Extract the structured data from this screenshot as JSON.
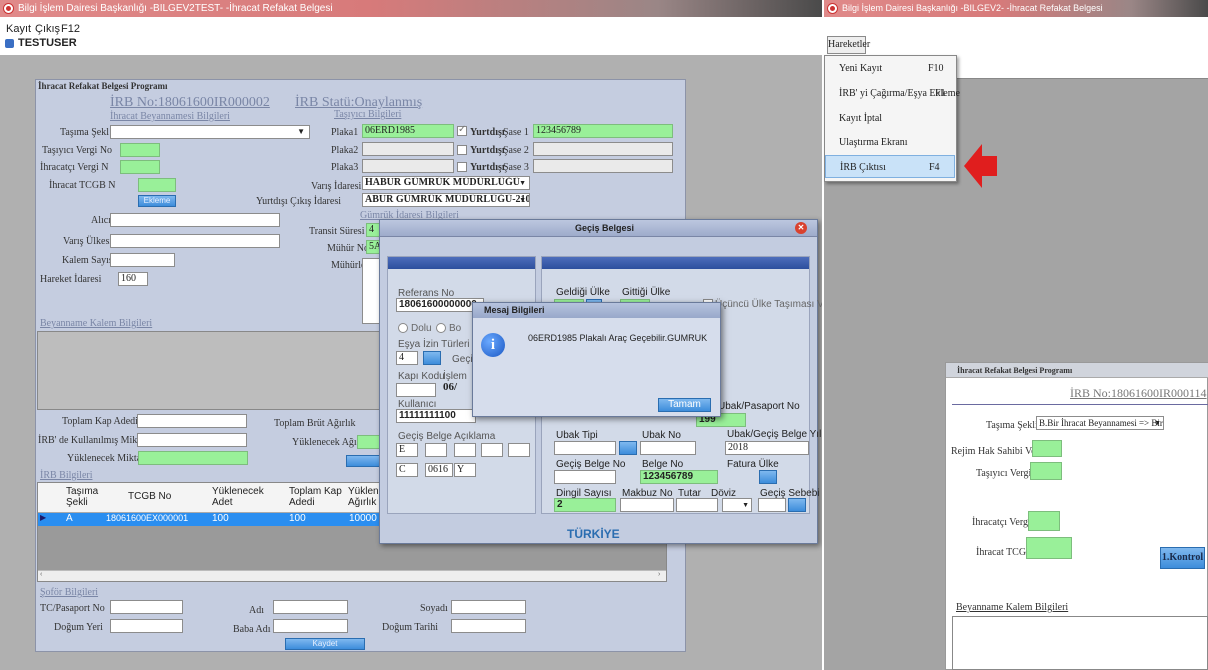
{
  "left": {
    "title": "Bilgi İşlem Dairesi Başkanlığı -BILGEV2TEST- -İhracat Refakat Belgesi",
    "menu": [
      "Kayıt",
      "Çıkış",
      "F12"
    ],
    "user": "TESTUSER"
  },
  "main": {
    "title": "İhracat Refakat Belgesi Programı",
    "irb_no": "İRB No:18061600IR000002",
    "irb_status": "İRB Statü:Onaylanmış",
    "decl_info": "İhracat Beyannamesi Bilgileri",
    "carrier_info": "Taşıyıcı Bilgileri",
    "customs_info": "Gümrük İdaresi Bilgileri",
    "labels": {
      "tasima": "Taşıma Şekl",
      "tasiyici_vergi": "Taşıyıcı Vergi No",
      "ihracatci_vergi": "İhracatçı Vergi N",
      "ihracat_tcgb": "İhracat TCGB N",
      "alici": "Alıcı",
      "varis_ulkesi": "Varış Ülkesi",
      "kalem": "Kalem Sayısı",
      "hareket": "Hareket İdaresi",
      "plaka1": "Plaka1",
      "plaka2": "Plaka2",
      "plaka3": "Plaka3",
      "yurtdisi": "Yurtdışı",
      "sase1": "Şase 1",
      "sase2": "Şase 2",
      "sase3": "Şase 3",
      "varis_idare": "Varış İdaresi",
      "yurtdisi_cikis": "Yurtdışı Çıkış İdaresi",
      "transit": "Transit Süresi",
      "muhur_no": "Mühür No",
      "muhurler": "Mühürler"
    },
    "values": {
      "plaka1": "06ERD1985",
      "sase1": "123456789",
      "varis_idare": "HABUR GÜMRÜK MÜDÜRLÜĞÜ",
      "yurtdisi_cikis": "ABUR GÜMRÜK MÜDÜRLÜĞÜ-210-",
      "transit": "4",
      "muhur_no": "5A",
      "hareket": "160"
    },
    "ekleme": "Ekleme",
    "kalem_title": "Beyanname Kalem Bilgileri",
    "toplam_kap": "Toplam Kap Adedi",
    "irb_kullanilmis": "İRB' de Kullanılmış Miktar",
    "yuklenecek_miktar": "Yüklenecek Miktar",
    "toplam_brut": "Toplam Brüt Ağırlık",
    "yuklenecek_agirlik": "Yüklenecek Ağırlık",
    "irb_bilgileri": "İRB Bilgileri",
    "grid_headers": [
      "Taşıma Şekli",
      "TCGB No",
      "Yüklenecek Adet",
      "Toplam Kap Adedi",
      "Yüklenec Ağırlık"
    ],
    "grid_row": [
      "A",
      "18061600EX000001",
      "100",
      "100",
      "10000"
    ],
    "sofor": "Şoför Bilgileri",
    "tc": "TC/Pasaport No",
    "adi": "Adı",
    "soyadi": "Soyadı",
    "dogum_yeri": "Doğum Yeri",
    "baba_adi": "Baba Adı",
    "dogum_tarihi": "Doğum Tarihi",
    "kaydet": "Kaydet"
  },
  "gecis": {
    "title": "Geçiş Belgesi",
    "referans": "Referans No",
    "referans_val": "18061600000000",
    "dolu": "Dolu",
    "bos": "Bo",
    "esya": "Eşya İzin Türleri",
    "esya_val": "4",
    "gecis": "Geçi",
    "kapi": "Kapı Kodu",
    "islem": "İşlem",
    "islem_val": "06/",
    "kullanici": "Kullanıcı",
    "kullanici_val": "11111111100",
    "aciklama": "Geçiş Belge Açıklama",
    "e": "E",
    "c": "C",
    "c_val": "0616",
    "y": "Y",
    "geldigi": "Geldiği Ülke",
    "gittigi": "Gittiği Ülke",
    "ucuncu": "Üçüncü Ülke Taşıması Va",
    "pasaport": "Ubak/Pasaport No",
    "pasaport_val": "199",
    "ubak_tipi": "Ubak Tipi",
    "ubak_no": "Ubak No",
    "ubak_yil": "Ubak/Geçiş Belge Yılı",
    "ubak_yil_val": "2018",
    "gecis_belge_no": "Geçiş Belge No",
    "belge_no": "Belge No",
    "belge_val": "123456789",
    "fatura": "Fatura Ülke",
    "dingil": "Dingil Sayısı",
    "dingil_val": "2",
    "makbuz": "Makbuz No",
    "tutar": "Tutar",
    "doviz": "Döviz",
    "sebebi": "Geçiş Sebebi",
    "turkiye": "TÜRKİYE"
  },
  "msg": {
    "title": "Mesaj Bilgileri",
    "text": "06ERD1985 Plakalı Araç Geçebilir.GUMRUK",
    "ok": "Tamam"
  },
  "right": {
    "title": "Bilgi İşlem Dairesi Başkanlığı -BILGEV2- -İhracat Refakat Belgesi",
    "menu_title": "Hareketler",
    "items": [
      {
        "label": "Yeni Kayıt",
        "key": "F10"
      },
      {
        "label": "İRB' yi Çağırma/Eşya Ekleme",
        "key": "F1"
      },
      {
        "label": "Kayıt İptal",
        "key": ""
      },
      {
        "label": "Ulaştırma Ekranı",
        "key": ""
      },
      {
        "label": "İRB Çıktısı",
        "key": "F4"
      }
    ]
  },
  "second": {
    "title": "İhracat Refakat Belgesi Programı",
    "irb_no": "İRB No:18061600IR000114",
    "tasima": "Taşıma Şekli",
    "tasima_val": "B.Bir İhracat Beyannamesi => Birden Çok",
    "rejim": "Rejim Hak Sahibi Vergi No",
    "tasiyici": "Taşıyıcı Vergi No",
    "ihracatci": "İhracatçı Vergi No",
    "tcgb": "İhracat TCGB No",
    "kontrol": "1.Kontrol",
    "kalem": "Beyanname Kalem Bilgileri"
  }
}
